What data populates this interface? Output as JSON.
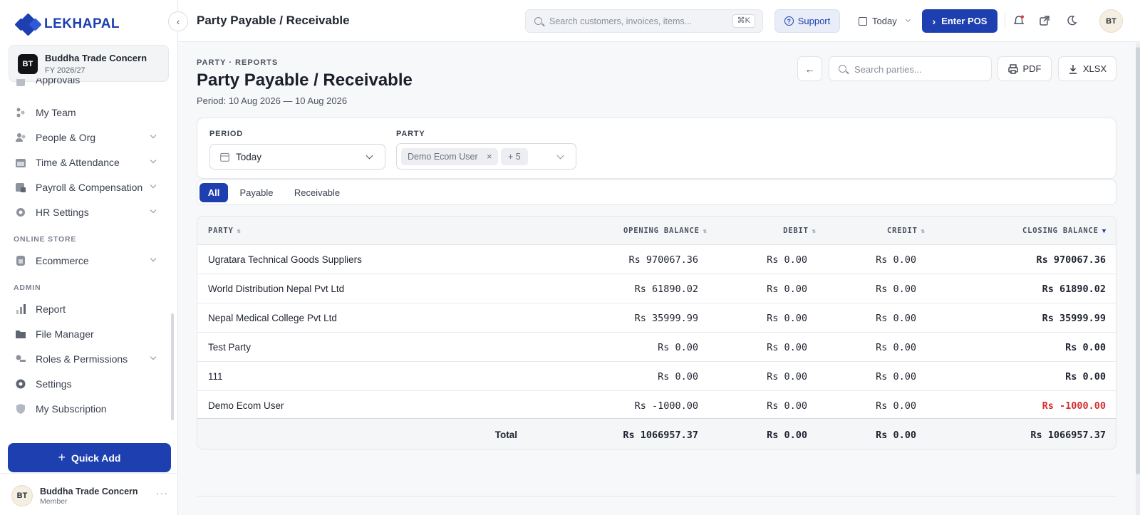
{
  "brand": {
    "name": "LEKHAPAL",
    "color": "#1d3fb0"
  },
  "org": {
    "initials": "BT",
    "name": "Buddha Trade Concern",
    "fy": "FY 2026/27"
  },
  "sidebar": {
    "items": [
      {
        "label": "Approvals",
        "icon": "approvals-icon"
      },
      {
        "label": "My Team",
        "icon": "team-icon"
      },
      {
        "label": "People & Org",
        "icon": "people-icon"
      },
      {
        "label": "Time & Attendance",
        "icon": "calendar-icon"
      },
      {
        "label": "Payroll & Compensation",
        "icon": "payroll-icon"
      },
      {
        "label": "HR Settings",
        "icon": "gear-icon"
      },
      {
        "label": "Ecommerce",
        "icon": "store-icon"
      },
      {
        "label": "Report",
        "icon": "chart-icon"
      },
      {
        "label": "File Manager",
        "icon": "folder-icon"
      },
      {
        "label": "Roles & Permissions",
        "icon": "key-icon"
      },
      {
        "label": "Settings",
        "icon": "settings-icon"
      },
      {
        "label": "My Subscription",
        "icon": "shield-icon"
      }
    ],
    "sections": {
      "online_store": "ONLINE STORE",
      "admin": "ADMIN"
    },
    "quick_add": "Quick Add",
    "user": {
      "initials": "BT",
      "name": "Buddha Trade Concern",
      "role": "Member",
      "more": "···"
    }
  },
  "topbar": {
    "title": "Party Payable / Receivable",
    "search_placeholder": "Search customers, invoices, items...",
    "shortcut": "⌘K",
    "support": "Support",
    "date_filter": "Today",
    "enter_pos": "Enter POS",
    "avatar": "BT"
  },
  "page": {
    "eyebrow": "PARTY · REPORTS",
    "title": "Party Payable / Receivable",
    "period": "Period: 10 Aug 2026 — 10 Aug 2026",
    "search_placeholder": "Search parties...",
    "pdf": "PDF",
    "xlsx": "XLSX"
  },
  "filters": {
    "period_label": "PERIOD",
    "period_value": "Today",
    "party_label": "PARTY",
    "party_chip": "Demo Ecom User",
    "party_more": "+ 5"
  },
  "tabs": [
    {
      "label": "All",
      "active": true
    },
    {
      "label": "Payable",
      "active": false
    },
    {
      "label": "Receivable",
      "active": false
    }
  ],
  "table": {
    "headers": {
      "party": "PARTY",
      "opening": "OPENING BALANCE",
      "debit": "DEBIT",
      "credit": "CREDIT",
      "closing": "CLOSING BALANCE"
    },
    "rows": [
      {
        "party": "Ugratara Technical Goods Suppliers",
        "opening": "Rs 970067.36",
        "debit": "Rs 0.00",
        "credit": "Rs 0.00",
        "closing": "Rs 970067.36"
      },
      {
        "party": "World Distribution Nepal Pvt Ltd",
        "opening": "Rs 61890.02",
        "debit": "Rs 0.00",
        "credit": "Rs 0.00",
        "closing": "Rs 61890.02"
      },
      {
        "party": "Nepal Medical College Pvt Ltd",
        "opening": "Rs 35999.99",
        "debit": "Rs 0.00",
        "credit": "Rs 0.00",
        "closing": "Rs 35999.99"
      },
      {
        "party": "Test Party",
        "opening": "Rs 0.00",
        "debit": "Rs 0.00",
        "credit": "Rs 0.00",
        "closing": "Rs 0.00"
      },
      {
        "party": "111",
        "opening": "Rs 0.00",
        "debit": "Rs 0.00",
        "credit": "Rs 0.00",
        "closing": "Rs 0.00"
      },
      {
        "party": "Demo Ecom User",
        "opening": "Rs -1000.00",
        "debit": "Rs 0.00",
        "credit": "Rs 0.00",
        "closing": "Rs -1000.00"
      }
    ],
    "total": {
      "label": "Total",
      "opening": "Rs 1066957.37",
      "debit": "Rs 0.00",
      "credit": "Rs 0.00",
      "closing": "Rs 1066957.37"
    }
  },
  "colors": {
    "accent": "#1d3fb0",
    "negative": "#d32f2f"
  }
}
